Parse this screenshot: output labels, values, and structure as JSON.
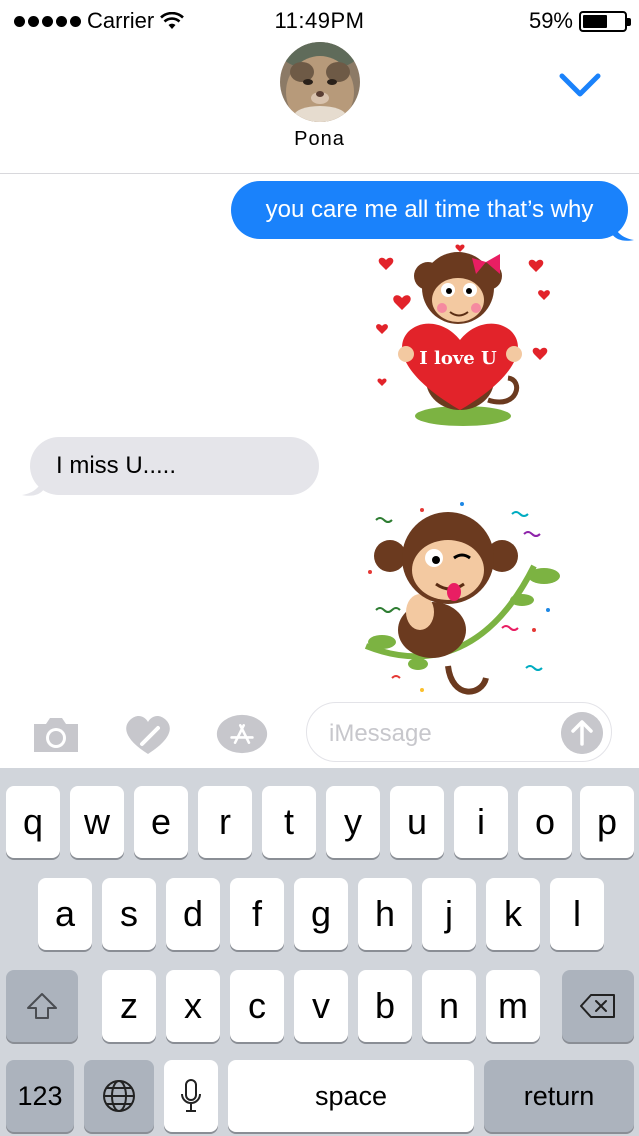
{
  "status_bar": {
    "carrier": "Carrier",
    "time": "11:49PM",
    "battery_text": "59%",
    "battery_level": 0.59,
    "icons": [
      "signal-dots-icon",
      "wifi-icon",
      "battery-icon"
    ]
  },
  "header": {
    "contact_name": "Pona",
    "avatar": "cat-photo-avatar",
    "details_icon": "chevron-down-icon"
  },
  "messages": [
    {
      "from": "me",
      "type": "text",
      "text": "you care me all time  that’s why"
    },
    {
      "from": "me",
      "type": "sticker",
      "sticker_name": "monkey-heart-sticker",
      "caption": "I love U"
    },
    {
      "from": "them",
      "type": "text",
      "text": "I miss U....."
    },
    {
      "from": "me",
      "type": "sticker",
      "sticker_name": "monkey-branch-sticker"
    }
  ],
  "input_bar": {
    "placeholder": "iMessage",
    "icons": [
      "camera-icon",
      "digital-touch-icon",
      "app-store-icon",
      "send-arrow-icon"
    ]
  },
  "keyboard": {
    "row1": [
      "q",
      "w",
      "e",
      "r",
      "t",
      "y",
      "u",
      "i",
      "o",
      "p"
    ],
    "row2": [
      "a",
      "s",
      "d",
      "f",
      "g",
      "h",
      "j",
      "k",
      "l"
    ],
    "row3": [
      "z",
      "x",
      "c",
      "v",
      "b",
      "n",
      "m"
    ],
    "numbers_label": "123",
    "space_label": "space",
    "return_label": "return"
  },
  "colors": {
    "accent": "#1a82fb",
    "incoming_bubble": "#e5e5ea",
    "keyboard_bg": "#d1d5db",
    "special_key": "#acb3bd"
  }
}
